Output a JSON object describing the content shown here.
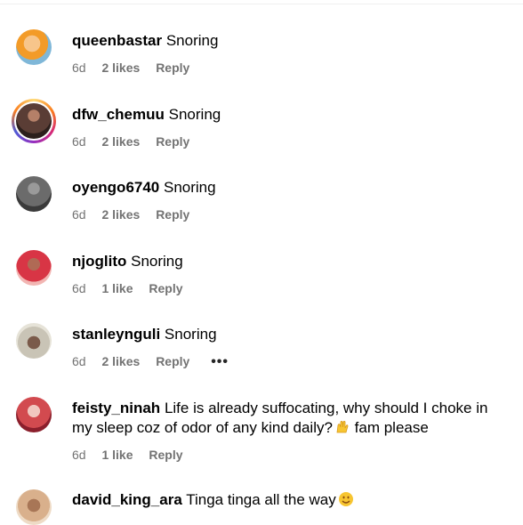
{
  "comments": [
    {
      "username": "queenbastar",
      "text": "Snoring",
      "time": "6d",
      "likes": "2 likes",
      "reply": "Reply",
      "avatar_color": "#f39b28"
    },
    {
      "username": "dfw_chemuu",
      "text": "Snoring",
      "time": "6d",
      "likes": "2 likes",
      "reply": "Reply",
      "avatar_color": "#5a3d35"
    },
    {
      "username": "oyengo6740",
      "text": "Snoring",
      "time": "6d",
      "likes": "2 likes",
      "reply": "Reply",
      "avatar_color": "#6b6b6b"
    },
    {
      "username": "njoglito",
      "text": "Snoring",
      "time": "6d",
      "likes": "1 like",
      "reply": "Reply",
      "avatar_color": "#d83545"
    },
    {
      "username": "stanleynguli",
      "text": "Snoring",
      "time": "6d",
      "likes": "2 likes",
      "reply": "Reply",
      "more": "•••",
      "avatar_color": "#c9c4b6"
    },
    {
      "username": "feisty_ninah",
      "text": "Life is already suffocating, why should I choke in my sleep coz of odor of any kind daily?",
      "text_tail": " fam please",
      "time": "6d",
      "likes": "1 like",
      "reply": "Reply",
      "avatar_color": "#d24a4f"
    },
    {
      "username": "david_king_ara",
      "text": "Tinga tinga all the way",
      "avatar_color": "#d9b08c"
    }
  ],
  "icons": {
    "raised_hands": "raised-hands-emoji",
    "smile": "smiling-face-emoji"
  },
  "colors": {
    "meta_text": "#737373",
    "ring_gradient": [
      "#feda75",
      "#fa7e1e",
      "#d62976",
      "#962fbf",
      "#4f5bd5"
    ]
  }
}
